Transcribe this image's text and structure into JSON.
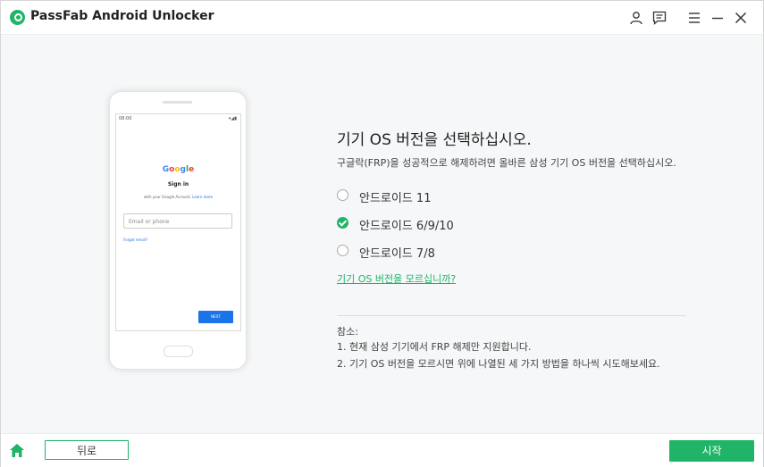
{
  "app": {
    "title": "PassFab Android Unlocker"
  },
  "header_icons": [
    "account-icon",
    "feedback-icon",
    "menu-icon",
    "minimize-icon",
    "close-icon"
  ],
  "phone": {
    "time": "08:00",
    "status": "▾◢▮",
    "google": [
      "G",
      "o",
      "o",
      "g",
      "l",
      "e"
    ],
    "sign_in": "Sign in",
    "with_google_prefix": "with your Google Account.",
    "learn_more": "Learn more",
    "email_placeholder": "Email or phone",
    "forgot_email": "Forgot email?",
    "next": "NEXT"
  },
  "main": {
    "heading": "기기 OS 버전을 선택하십시오.",
    "subtitle": "구글락(FRP)을 성공적으로 해제하려면 올바른 삼성 기기 OS 버전을 선택하십시오.",
    "options": [
      {
        "label": "안드로이드 11",
        "checked": false
      },
      {
        "label": "안드로이드 6/9/10",
        "checked": true
      },
      {
        "label": "안드로이드 7/8",
        "checked": false
      }
    ],
    "help_link": "기기 OS 버전을 모르십니까?",
    "notes_title": "참소:",
    "notes": [
      "1. 현재 삼성 기기에서 FRP 해제만 지원합니다.",
      "2. 기기 OS 버전을 모르시면 위에 나열된 세 가지 방법을 하나씩 시도해보세요."
    ]
  },
  "footer": {
    "back": "뒤로",
    "start": "시작"
  },
  "colors": {
    "accent": "#1fb467",
    "google_blue": "#1a73e8"
  }
}
